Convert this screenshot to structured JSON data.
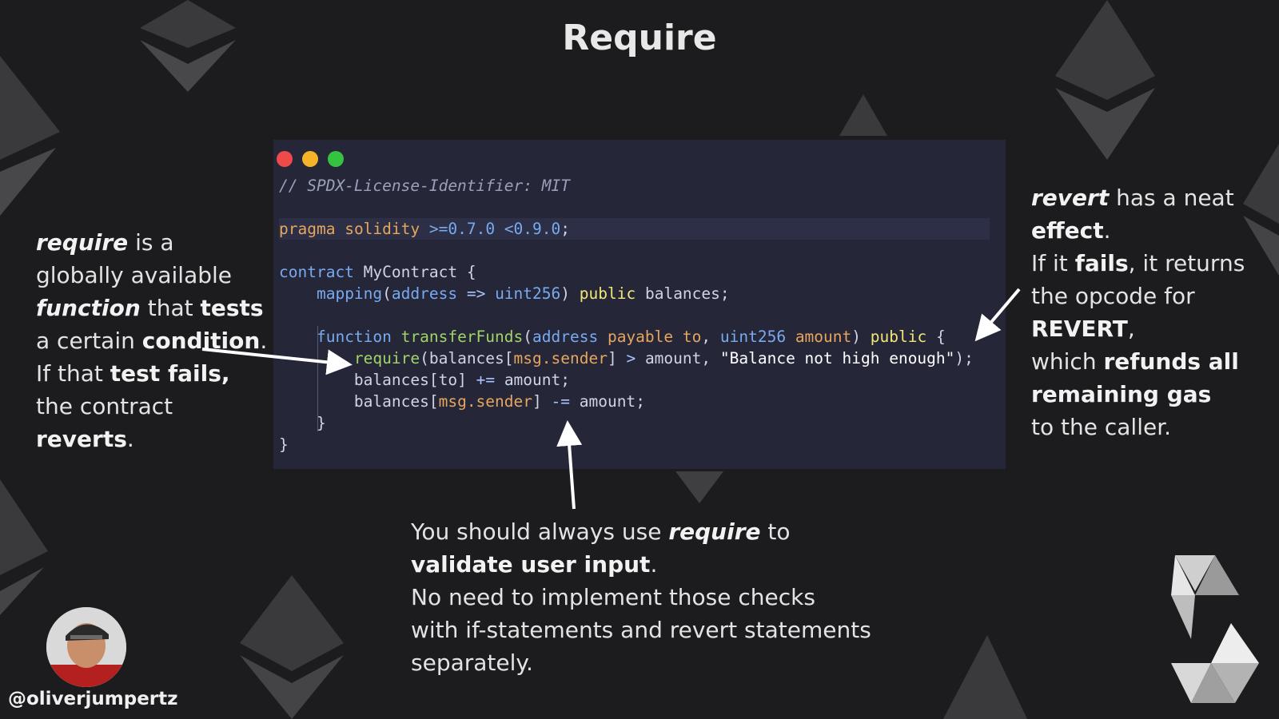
{
  "title": "Require",
  "window_controls": {
    "close_color": "#ef4a4a",
    "minimize_color": "#f5b32a",
    "maximize_color": "#35c43f"
  },
  "code_lines": [
    "// SPDX-License-Identifier: MIT",
    "",
    "pragma solidity >=0.7.0 <0.9.0;",
    "",
    "contract MyContract {",
    "    mapping(address => uint256) public balances;",
    "",
    "    function transferFunds(address payable to, uint256 amount) public {",
    "        require(balances[msg.sender] > amount, \"Balance not high enough\");",
    "        balances[to] += amount;",
    "        balances[msg.sender] -= amount;",
    "    }",
    "}"
  ],
  "notes": {
    "left": [
      {
        "t": "require",
        "s": "bi"
      },
      {
        "t": " is a globally available ",
        "s": ""
      },
      {
        "t": "function",
        "s": "bi"
      },
      {
        "t": " that ",
        "s": ""
      },
      {
        "t": "tests",
        "s": "b"
      },
      {
        "t": " a certain ",
        "s": ""
      },
      {
        "t": "condition",
        "s": "b"
      },
      {
        "t": ".",
        "s": ""
      },
      {
        "t": "\n",
        "s": ""
      },
      {
        "t": "If that ",
        "s": ""
      },
      {
        "t": "test fails,",
        "s": "b"
      },
      {
        "t": " the contract ",
        "s": ""
      },
      {
        "t": "reverts",
        "s": "b"
      },
      {
        "t": ".",
        "s": ""
      }
    ],
    "right": [
      {
        "t": "revert",
        "s": "bi"
      },
      {
        "t": " has a neat ",
        "s": ""
      },
      {
        "t": "effect",
        "s": "b"
      },
      {
        "t": ".",
        "s": ""
      },
      {
        "t": "\n",
        "s": ""
      },
      {
        "t": "If it ",
        "s": ""
      },
      {
        "t": "fails",
        "s": "b"
      },
      {
        "t": ", it returns the opcode for ",
        "s": ""
      },
      {
        "t": "REVERT",
        "s": "b"
      },
      {
        "t": ",",
        "s": ""
      },
      {
        "t": "\n",
        "s": ""
      },
      {
        "t": "which ",
        "s": ""
      },
      {
        "t": "refunds all remaining gas",
        "s": "b"
      },
      {
        "t": "\n",
        "s": ""
      },
      {
        "t": "to the caller.",
        "s": ""
      }
    ],
    "bottom": [
      {
        "t": "You should always use ",
        "s": ""
      },
      {
        "t": "require",
        "s": "bi"
      },
      {
        "t": " to",
        "s": ""
      },
      {
        "t": "\n",
        "s": ""
      },
      {
        "t": "validate user input",
        "s": "b"
      },
      {
        "t": ".",
        "s": ""
      },
      {
        "t": "\n",
        "s": ""
      },
      {
        "t": "No need to implement those checks",
        "s": ""
      },
      {
        "t": "\n",
        "s": ""
      },
      {
        "t": "with if-statements and revert statements",
        "s": ""
      },
      {
        "t": "\n",
        "s": ""
      },
      {
        "t": "separately.",
        "s": ""
      }
    ]
  },
  "author": {
    "handle": "@oliverjumpertz"
  },
  "icons": {
    "background": "ethereum-logo-icon",
    "corner": "solidity-logo-icon",
    "avatar": "avatar"
  }
}
